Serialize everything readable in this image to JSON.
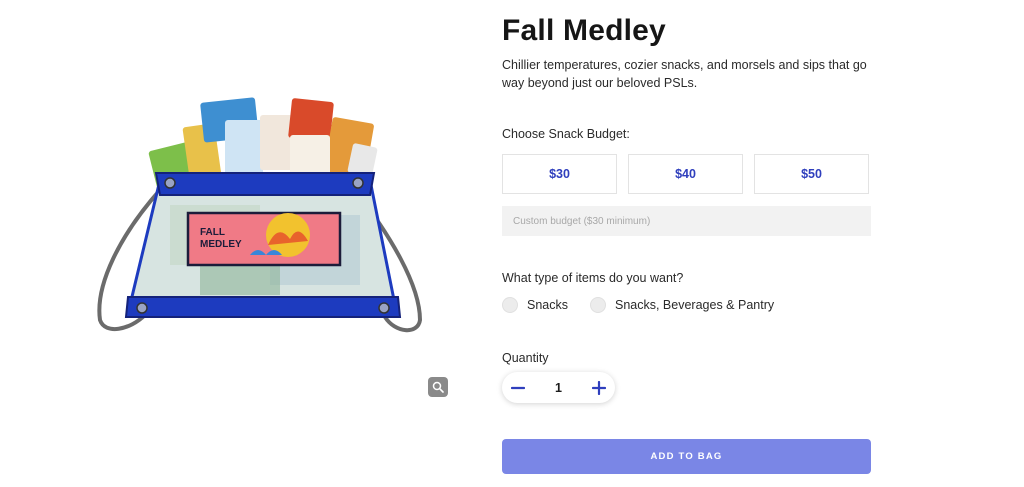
{
  "product": {
    "title": "Fall Medley",
    "description": "Chillier temperatures, cozier snacks, and morsels and sips that go way beyond just our beloved PSLs.",
    "image_label_line1": "FALL",
    "image_label_line2": "MEDLEY"
  },
  "budget": {
    "label": "Choose Snack Budget:",
    "options": [
      "$30",
      "$40",
      "$50"
    ],
    "custom_placeholder": "Custom budget ($30 minimum)"
  },
  "item_type": {
    "label": "What type of items do you want?",
    "options": [
      "Snacks",
      "Snacks, Beverages & Pantry"
    ]
  },
  "quantity": {
    "label": "Quantity",
    "value": "1"
  },
  "cart": {
    "add_label": "ADD TO BAG"
  },
  "colors": {
    "accent": "#2f3fbd",
    "button": "#7a86e6",
    "bag_blue": "#1d3bbf"
  },
  "icons": {
    "zoom": "magnifier-icon",
    "minus": "minus-icon",
    "plus": "plus-icon"
  }
}
